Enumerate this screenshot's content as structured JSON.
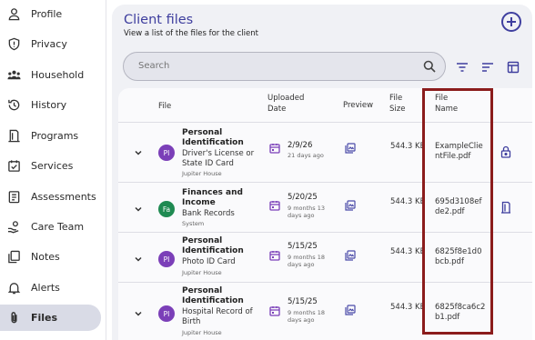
{
  "sidebar": {
    "items": [
      {
        "label": "Profile",
        "icon": "person-icon"
      },
      {
        "label": "Privacy",
        "icon": "shield-icon"
      },
      {
        "label": "Household",
        "icon": "household-icon"
      },
      {
        "label": "History",
        "icon": "history-icon"
      },
      {
        "label": "Programs",
        "icon": "programs-icon"
      },
      {
        "label": "Services",
        "icon": "services-icon"
      },
      {
        "label": "Assessments",
        "icon": "assessments-icon"
      },
      {
        "label": "Care Team",
        "icon": "care-team-icon"
      },
      {
        "label": "Notes",
        "icon": "notes-icon"
      },
      {
        "label": "Alerts",
        "icon": "bell-icon"
      },
      {
        "label": "Files",
        "icon": "paperclip-icon"
      }
    ],
    "active": "Files"
  },
  "header": {
    "title": "Client files",
    "subtitle": "View a list of the files for the client"
  },
  "search": {
    "placeholder": "Search"
  },
  "table": {
    "headers": {
      "file": "File",
      "uploaded_1": "Uploaded",
      "uploaded_2": "Date",
      "preview": "Preview",
      "size_1": "File",
      "size_2": "Size",
      "name_1": "File",
      "name_2": "Name"
    },
    "rows": [
      {
        "initials": "PI",
        "avatar_color": "#7b3fb8",
        "title": "Personal Identification",
        "desc": "Driver's License or State ID Card",
        "source": "Jupiter House",
        "date": "2/9/26",
        "ago": "21 days ago",
        "size": "544.3 KB",
        "filename": "ExampleClientFile.pdf",
        "action_icon": "lock-icon"
      },
      {
        "initials": "Fa",
        "avatar_color": "#1f8a52",
        "title": "Finances and Income",
        "desc": "Bank Records",
        "source": "System",
        "date": "5/20/25",
        "ago": "9 months 13 days ago",
        "size": "544.3 KB",
        "filename": "695d3108efde2.pdf",
        "action_icon": "door-icon"
      },
      {
        "initials": "PI",
        "avatar_color": "#7b3fb8",
        "title": "Personal Identification",
        "desc": "Photo ID Card",
        "source": "Jupiter House",
        "date": "5/15/25",
        "ago": "9 months 18 days ago",
        "size": "544.3 KB",
        "filename": "6825f8e1d0bcb.pdf",
        "action_icon": ""
      },
      {
        "initials": "PI",
        "avatar_color": "#7b3fb8",
        "title": "Personal Identification",
        "desc": "Hospital Record of Birth",
        "source": "Jupiter House",
        "date": "5/15/25",
        "ago": "9 months 18 days ago",
        "size": "544.3 KB",
        "filename": "6825f8ca6c2b1.pdf",
        "action_icon": ""
      }
    ]
  },
  "colors": {
    "accent": "#3e3e9e",
    "calendar": "#7a3fb8",
    "preview": "#4a4aa8",
    "highlight": "#8b1c1c",
    "active_nav": "#d9dbe6"
  }
}
